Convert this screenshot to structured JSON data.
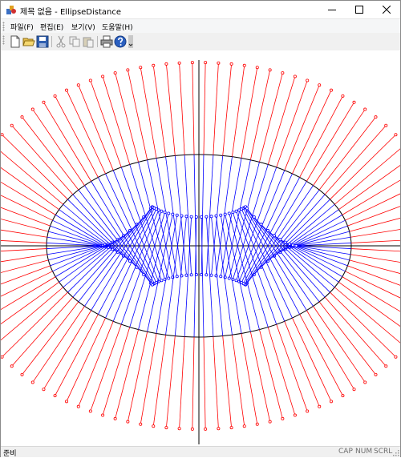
{
  "window": {
    "title": "제목 없음 - EllipseDistance"
  },
  "menu": [
    {
      "label": "파일(F)"
    },
    {
      "label": "편집(E)"
    },
    {
      "label": "보기(V)"
    },
    {
      "label": "도움말(H)"
    }
  ],
  "toolbar": {
    "buttons": [
      {
        "icon": "new-file-icon"
      },
      {
        "icon": "open-folder-icon"
      },
      {
        "icon": "save-icon"
      },
      {
        "icon": "cut-icon"
      },
      {
        "icon": "copy-icon"
      },
      {
        "icon": "paste-icon"
      },
      {
        "icon": "print-icon"
      },
      {
        "icon": "help-icon"
      }
    ]
  },
  "canvas": {
    "ellipse_color": "#000000",
    "axis_color": "#000000",
    "inner_line_color": "#0000ff",
    "outer_line_color": "#ff0000"
  },
  "status": {
    "text": "준비",
    "indicators": [
      "CAP",
      "NUM",
      "SCRL"
    ]
  }
}
